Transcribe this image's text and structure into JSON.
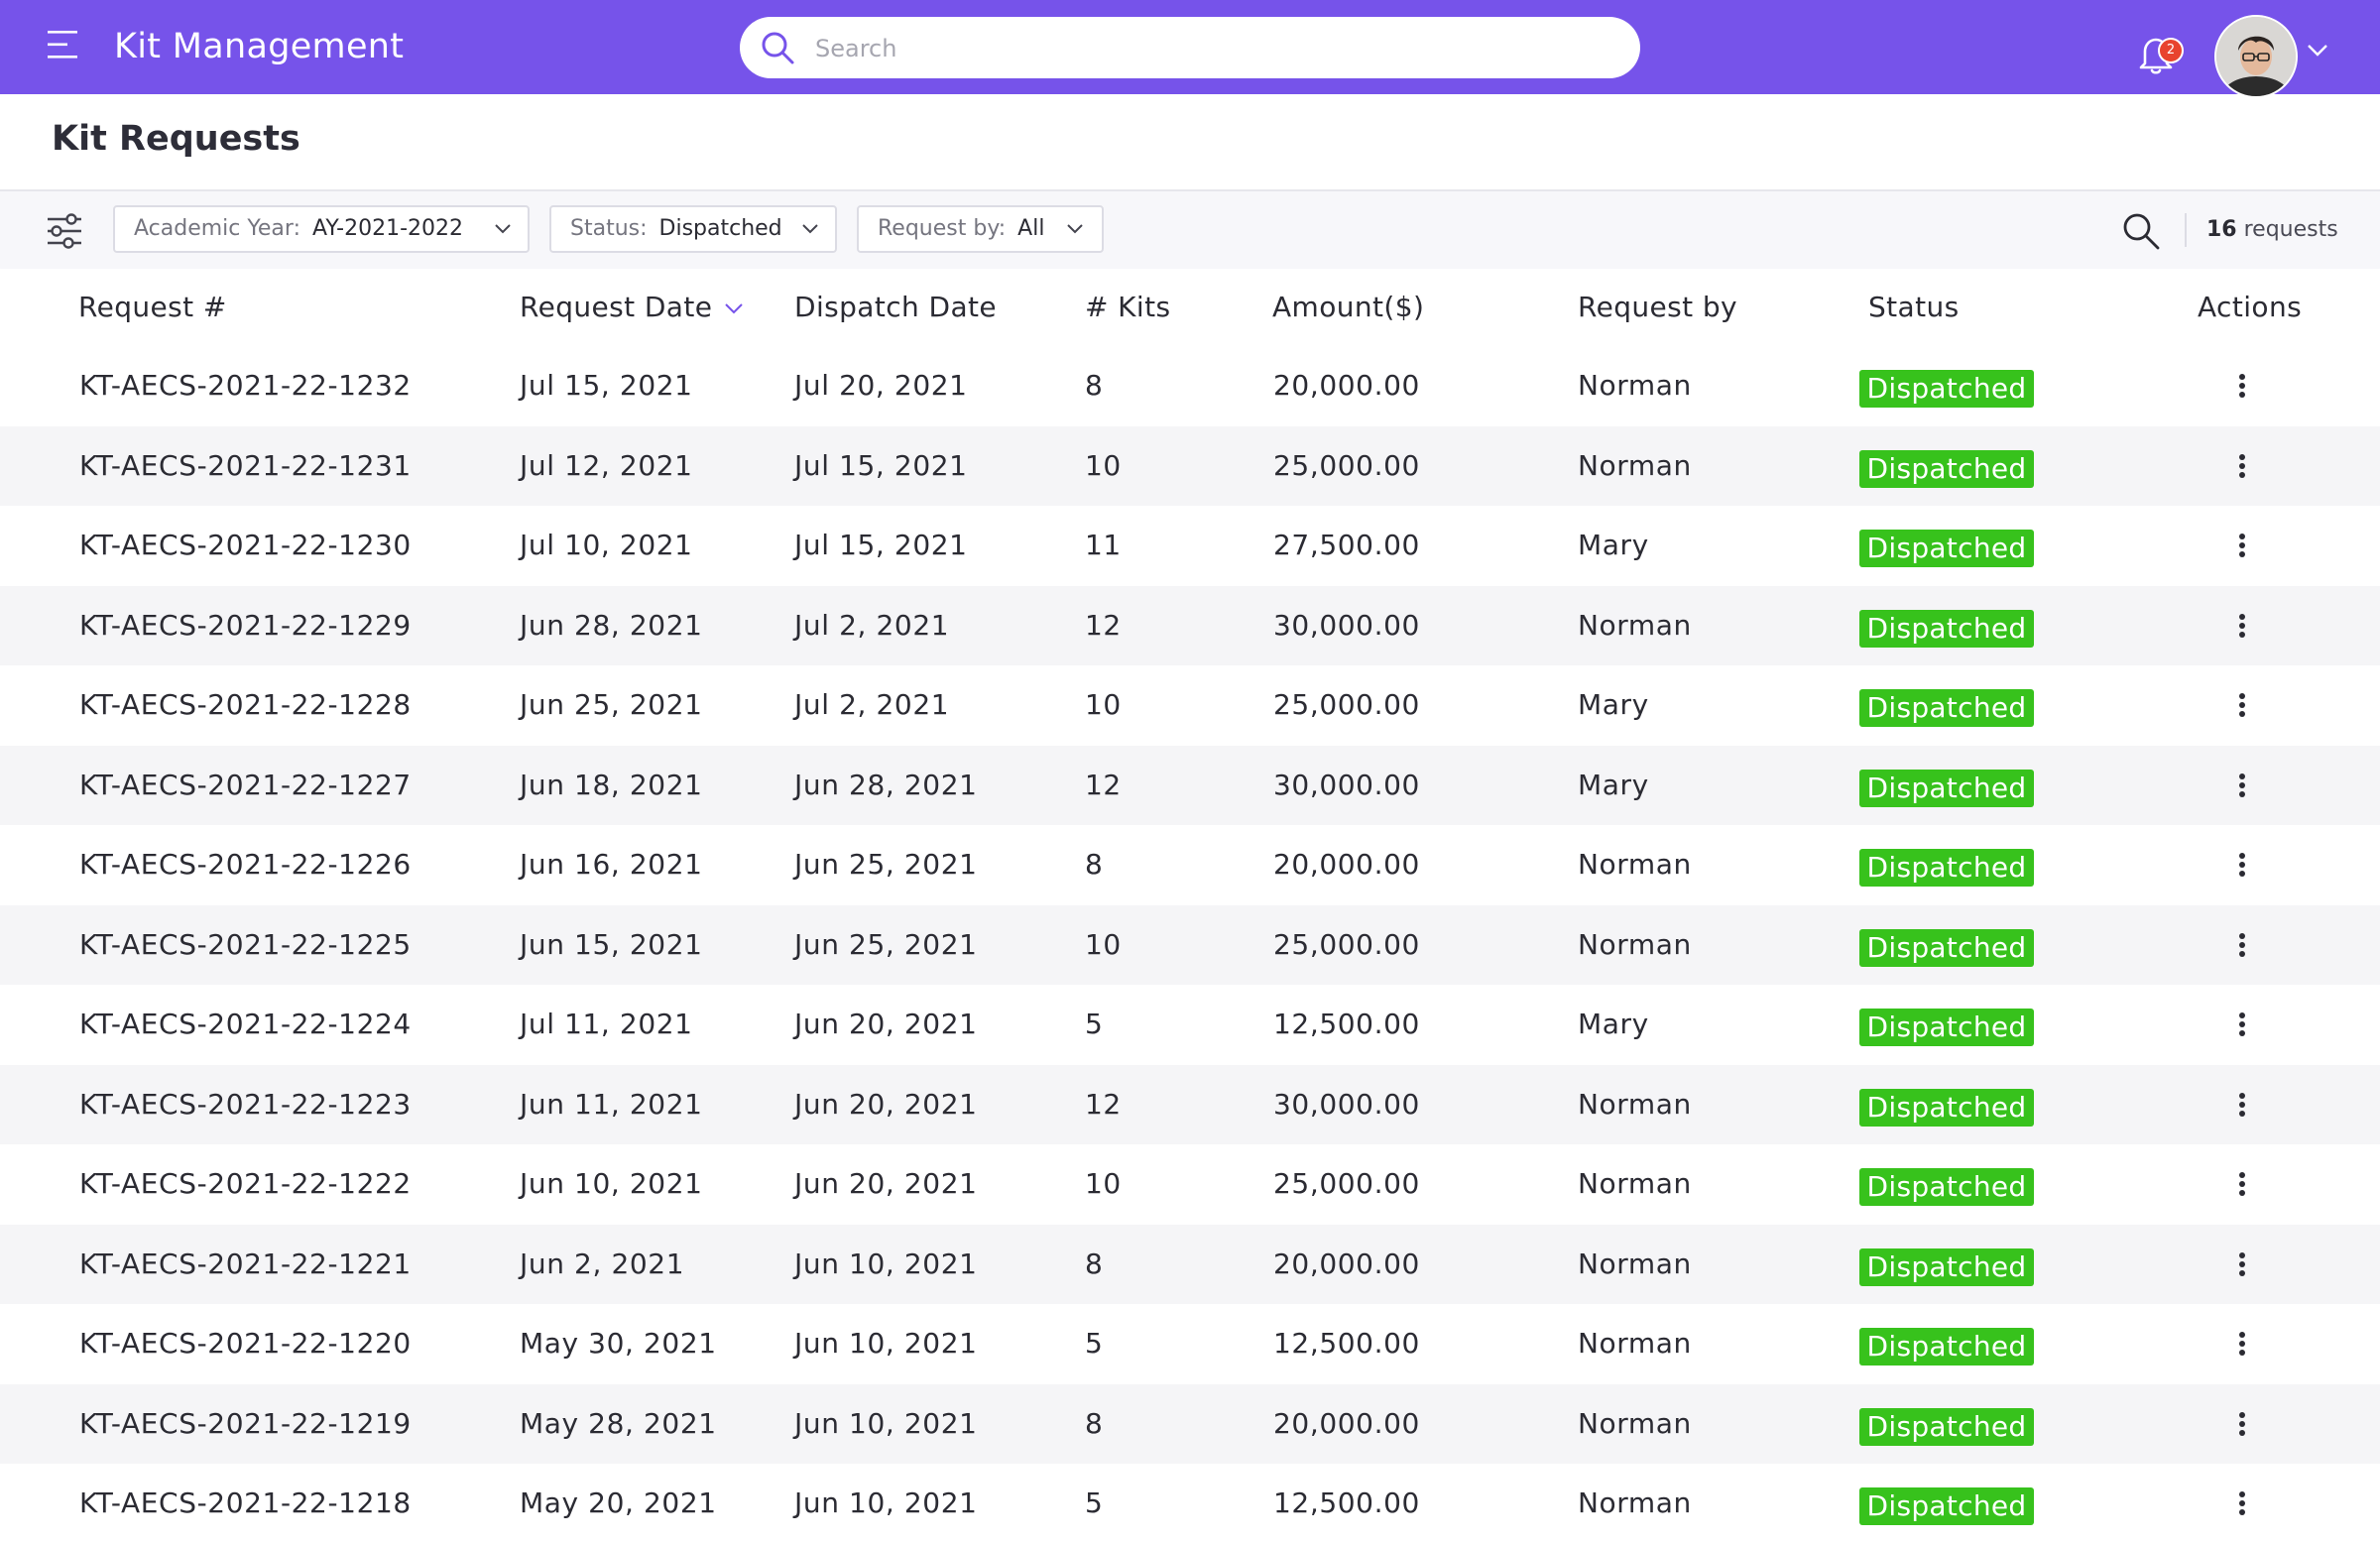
{
  "header": {
    "title": "Kit Management",
    "search_placeholder": "Search",
    "notification_count": "2"
  },
  "page": {
    "title": "Kit Requests"
  },
  "filters": {
    "academic_year": {
      "label": "Academic Year:",
      "value": "AY-2021-2022"
    },
    "status": {
      "label": "Status:",
      "value": "Dispatched"
    },
    "request_by": {
      "label": "Request by:",
      "value": "All"
    },
    "count": {
      "number": "16",
      "suffix": "requests"
    }
  },
  "table": {
    "columns": [
      "Request #",
      "Request Date",
      "Dispatch Date",
      "# Kits",
      "Amount($)",
      "Request by",
      "Status",
      "Actions"
    ],
    "sorted_column": "Request Date",
    "rows": [
      {
        "id": "KT-AECS-2021-22-1232",
        "request_date": "Jul 15, 2021",
        "dispatch_date": "Jul 20, 2021",
        "kits": "8",
        "amount": "20,000.00",
        "request_by": "Norman",
        "status": "Dispatched"
      },
      {
        "id": "KT-AECS-2021-22-1231",
        "request_date": "Jul 12, 2021",
        "dispatch_date": "Jul 15, 2021",
        "kits": "10",
        "amount": "25,000.00",
        "request_by": "Norman",
        "status": "Dispatched"
      },
      {
        "id": "KT-AECS-2021-22-1230",
        "request_date": "Jul 10, 2021",
        "dispatch_date": "Jul 15, 2021",
        "kits": "11",
        "amount": "27,500.00",
        "request_by": "Mary",
        "status": "Dispatched"
      },
      {
        "id": "KT-AECS-2021-22-1229",
        "request_date": "Jun 28, 2021",
        "dispatch_date": "Jul 2, 2021",
        "kits": "12",
        "amount": "30,000.00",
        "request_by": "Norman",
        "status": "Dispatched"
      },
      {
        "id": "KT-AECS-2021-22-1228",
        "request_date": "Jun 25, 2021",
        "dispatch_date": "Jul 2, 2021",
        "kits": "10",
        "amount": "25,000.00",
        "request_by": "Mary",
        "status": "Dispatched"
      },
      {
        "id": "KT-AECS-2021-22-1227",
        "request_date": "Jun 18, 2021",
        "dispatch_date": "Jun 28, 2021",
        "kits": "12",
        "amount": "30,000.00",
        "request_by": "Mary",
        "status": "Dispatched"
      },
      {
        "id": "KT-AECS-2021-22-1226",
        "request_date": "Jun 16, 2021",
        "dispatch_date": "Jun 25, 2021",
        "kits": "8",
        "amount": "20,000.00",
        "request_by": "Norman",
        "status": "Dispatched"
      },
      {
        "id": "KT-AECS-2021-22-1225",
        "request_date": "Jun 15, 2021",
        "dispatch_date": "Jun 25, 2021",
        "kits": "10",
        "amount": "25,000.00",
        "request_by": "Norman",
        "status": "Dispatched"
      },
      {
        "id": "KT-AECS-2021-22-1224",
        "request_date": "Jul 11, 2021",
        "dispatch_date": "Jun 20, 2021",
        "kits": "5",
        "amount": "12,500.00",
        "request_by": "Mary",
        "status": "Dispatched"
      },
      {
        "id": "KT-AECS-2021-22-1223",
        "request_date": "Jun 11, 2021",
        "dispatch_date": "Jun 20, 2021",
        "kits": "12",
        "amount": "30,000.00",
        "request_by": "Norman",
        "status": "Dispatched"
      },
      {
        "id": "KT-AECS-2021-22-1222",
        "request_date": "Jun 10, 2021",
        "dispatch_date": "Jun 20, 2021",
        "kits": "10",
        "amount": "25,000.00",
        "request_by": "Norman",
        "status": "Dispatched"
      },
      {
        "id": "KT-AECS-2021-22-1221",
        "request_date": "Jun 2, 2021",
        "dispatch_date": "Jun 10, 2021",
        "kits": "8",
        "amount": "20,000.00",
        "request_by": "Norman",
        "status": "Dispatched"
      },
      {
        "id": "KT-AECS-2021-22-1220",
        "request_date": "May 30, 2021",
        "dispatch_date": "Jun 10, 2021",
        "kits": "5",
        "amount": "12,500.00",
        "request_by": "Norman",
        "status": "Dispatched"
      },
      {
        "id": "KT-AECS-2021-22-1219",
        "request_date": "May 28, 2021",
        "dispatch_date": "Jun 10, 2021",
        "kits": "8",
        "amount": "20,000.00",
        "request_by": "Norman",
        "status": "Dispatched"
      },
      {
        "id": "KT-AECS-2021-22-1218",
        "request_date": "May 20, 2021",
        "dispatch_date": "Jun 10, 2021",
        "kits": "5",
        "amount": "12,500.00",
        "request_by": "Norman",
        "status": "Dispatched"
      }
    ]
  },
  "colors": {
    "topbar": "#7653ea",
    "status_dispatched": "#37c21c",
    "badge": "#e8432e"
  },
  "icons": [
    "menu-icon",
    "search-icon",
    "bell-icon",
    "avatar",
    "chevron-down-icon",
    "filter-sliders-icon",
    "more-vertical-icon",
    "sort-desc-icon"
  ]
}
